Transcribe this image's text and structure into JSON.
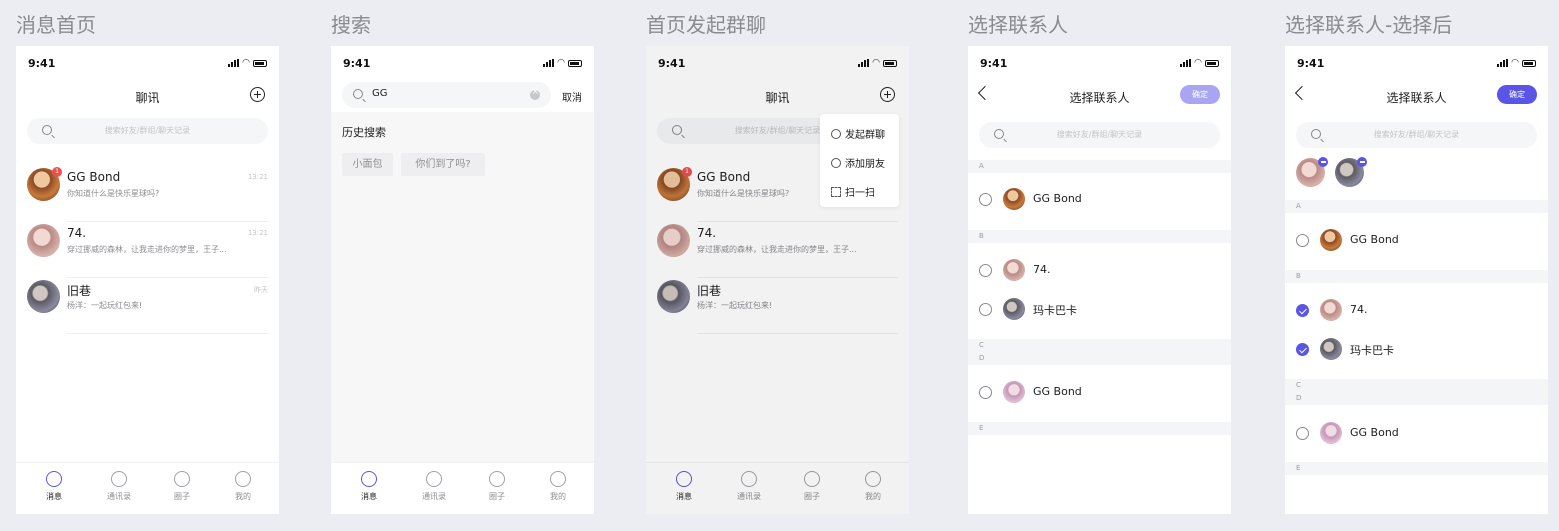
{
  "colors": {
    "accent": "#5a55e6",
    "accent_light": "#a9a5f3",
    "badge": "#ef4e4e"
  },
  "status_time": "9:41",
  "screens": [
    {
      "title": "消息首页"
    },
    {
      "title": "搜索"
    },
    {
      "title": "首页发起群聊"
    },
    {
      "title": "选择联系人"
    },
    {
      "title": "选择联系人-选择后"
    }
  ],
  "chat": {
    "nav_title": "聊讯",
    "search_placeholder": "搜索好友/群组/聊天记录",
    "items": [
      {
        "name": "GG Bond",
        "msg": "你知道什么是快乐星球吗?",
        "time": "13:21",
        "badge": "1"
      },
      {
        "name": "74.",
        "msg": "穿过挪威的森林，让我走进你的梦里，王子...",
        "time": "13:21"
      },
      {
        "name": "旧巷",
        "msg": "杨洋：一起玩红包来!",
        "time": "昨天"
      }
    ]
  },
  "tabs": [
    "消息",
    "通讯录",
    "圈子",
    "我的"
  ],
  "search": {
    "query": "GG",
    "cancel": "取消",
    "history_title": "历史搜索",
    "history": [
      "小面包",
      "你们到了吗?"
    ]
  },
  "menu": {
    "items": [
      "发起群聊",
      "添加朋友",
      "扫一扫"
    ]
  },
  "select": {
    "nav_title": "选择联系人",
    "confirm": "确定",
    "search_placeholder": "搜索好友/群组/聊天记录",
    "sections": [
      "A",
      "B",
      "C",
      "D",
      "E"
    ],
    "contacts": [
      {
        "section": "A",
        "name": "GG Bond"
      },
      {
        "section": "B",
        "name": "74."
      },
      {
        "section": "B",
        "name": "玛卡巴卡"
      },
      {
        "section": "D",
        "name": "GG Bond"
      }
    ]
  }
}
